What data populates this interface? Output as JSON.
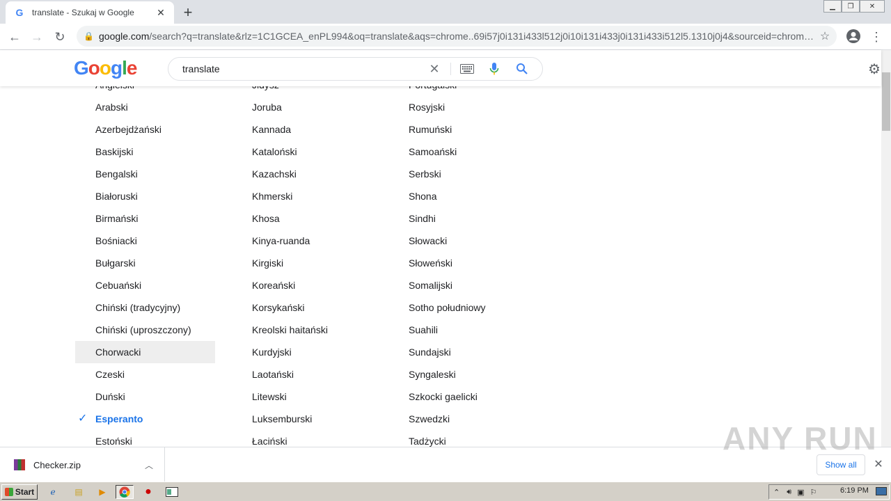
{
  "browser": {
    "tab_title": "translate - Szukaj w Google",
    "favicon": "G",
    "url_host": "google.com",
    "url_path": "/search?q=translate&rlz=1C1GCEA_enPL994&oq=translate&aqs=chrome..69i57j0i131i433l512j0i10i131i433j0i131i433i512l5.1310j0j4&sourceid=chrom…"
  },
  "google": {
    "logo": [
      "G",
      "o",
      "o",
      "g",
      "l",
      "e"
    ],
    "logo_colors": [
      "#4285f4",
      "#ea4335",
      "#fbbc05",
      "#4285f4",
      "#34a853",
      "#ea4335"
    ],
    "search_value": "translate"
  },
  "languages": {
    "col1": [
      "Angielski",
      "Arabski",
      "Azerbejdżański",
      "Baskijski",
      "Bengalski",
      "Białoruski",
      "Birmański",
      "Bośniacki",
      "Bułgarski",
      "Cebuański",
      "Chiński (tradycyjny)",
      "Chiński (uproszczony)",
      "Chorwacki",
      "Czeski",
      "Duński",
      "Esperanto",
      "Estoński"
    ],
    "col2": [
      "Jidysz",
      "Joruba",
      "Kannada",
      "Kataloński",
      "Kazachski",
      "Khmerski",
      "Khosa",
      "Kinya-ruanda",
      "Kirgiski",
      "Koreański",
      "Korsykański",
      "Kreolski haitański",
      "Kurdyjski",
      "Laotański",
      "Litewski",
      "Luksemburski",
      "Łaciński"
    ],
    "col3": [
      "Portugalski",
      "Rosyjski",
      "Rumuński",
      "Samoański",
      "Serbski",
      "Shona",
      "Sindhi",
      "Słowacki",
      "Słoweński",
      "Somalijski",
      "Sotho południowy",
      "Suahili",
      "Sundajski",
      "Syngaleski",
      "Szkocki gaelicki",
      "Szwedzki",
      "Tadżycki"
    ],
    "highlighted": "Chorwacki",
    "selected": "Esperanto"
  },
  "download": {
    "file_name": "Checker.zip",
    "show_all": "Show all"
  },
  "watermark": "ANY RUN",
  "taskbar": {
    "start_label": "Start",
    "clock": "6:19 PM"
  }
}
